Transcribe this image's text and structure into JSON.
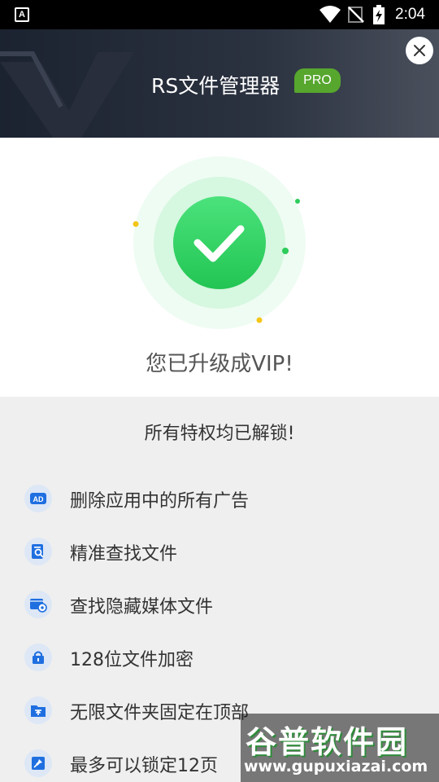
{
  "status_bar": {
    "time": "2:04",
    "app_indicator": "A"
  },
  "header": {
    "title": "RS文件管理器",
    "badge": "PRO",
    "close_icon": "close-icon"
  },
  "success": {
    "message": "您已升级成VIP!",
    "icon": "check-icon",
    "colors": {
      "accent": "#2ecc5a",
      "ring_light": "#eafaef",
      "ring_mid": "#c9f3d6"
    }
  },
  "privileges": {
    "heading": "所有特权均已解锁!",
    "items": [
      {
        "label": "删除应用中的所有广告",
        "icon": "ad-icon"
      },
      {
        "label": "精准查找文件",
        "icon": "file-search-icon"
      },
      {
        "label": "查找隐藏媒体文件",
        "icon": "hidden-media-icon"
      },
      {
        "label": "128位文件加密",
        "icon": "lock-icon"
      },
      {
        "label": "无限文件夹固定在顶部",
        "icon": "pin-top-folder-icon"
      },
      {
        "label": "最多可以锁定12页",
        "icon": "pin-icon"
      }
    ],
    "icon_color": "#1f6fe0"
  },
  "watermark": {
    "brand": "谷普软件园",
    "url": "www.gupuxiazai.com"
  }
}
